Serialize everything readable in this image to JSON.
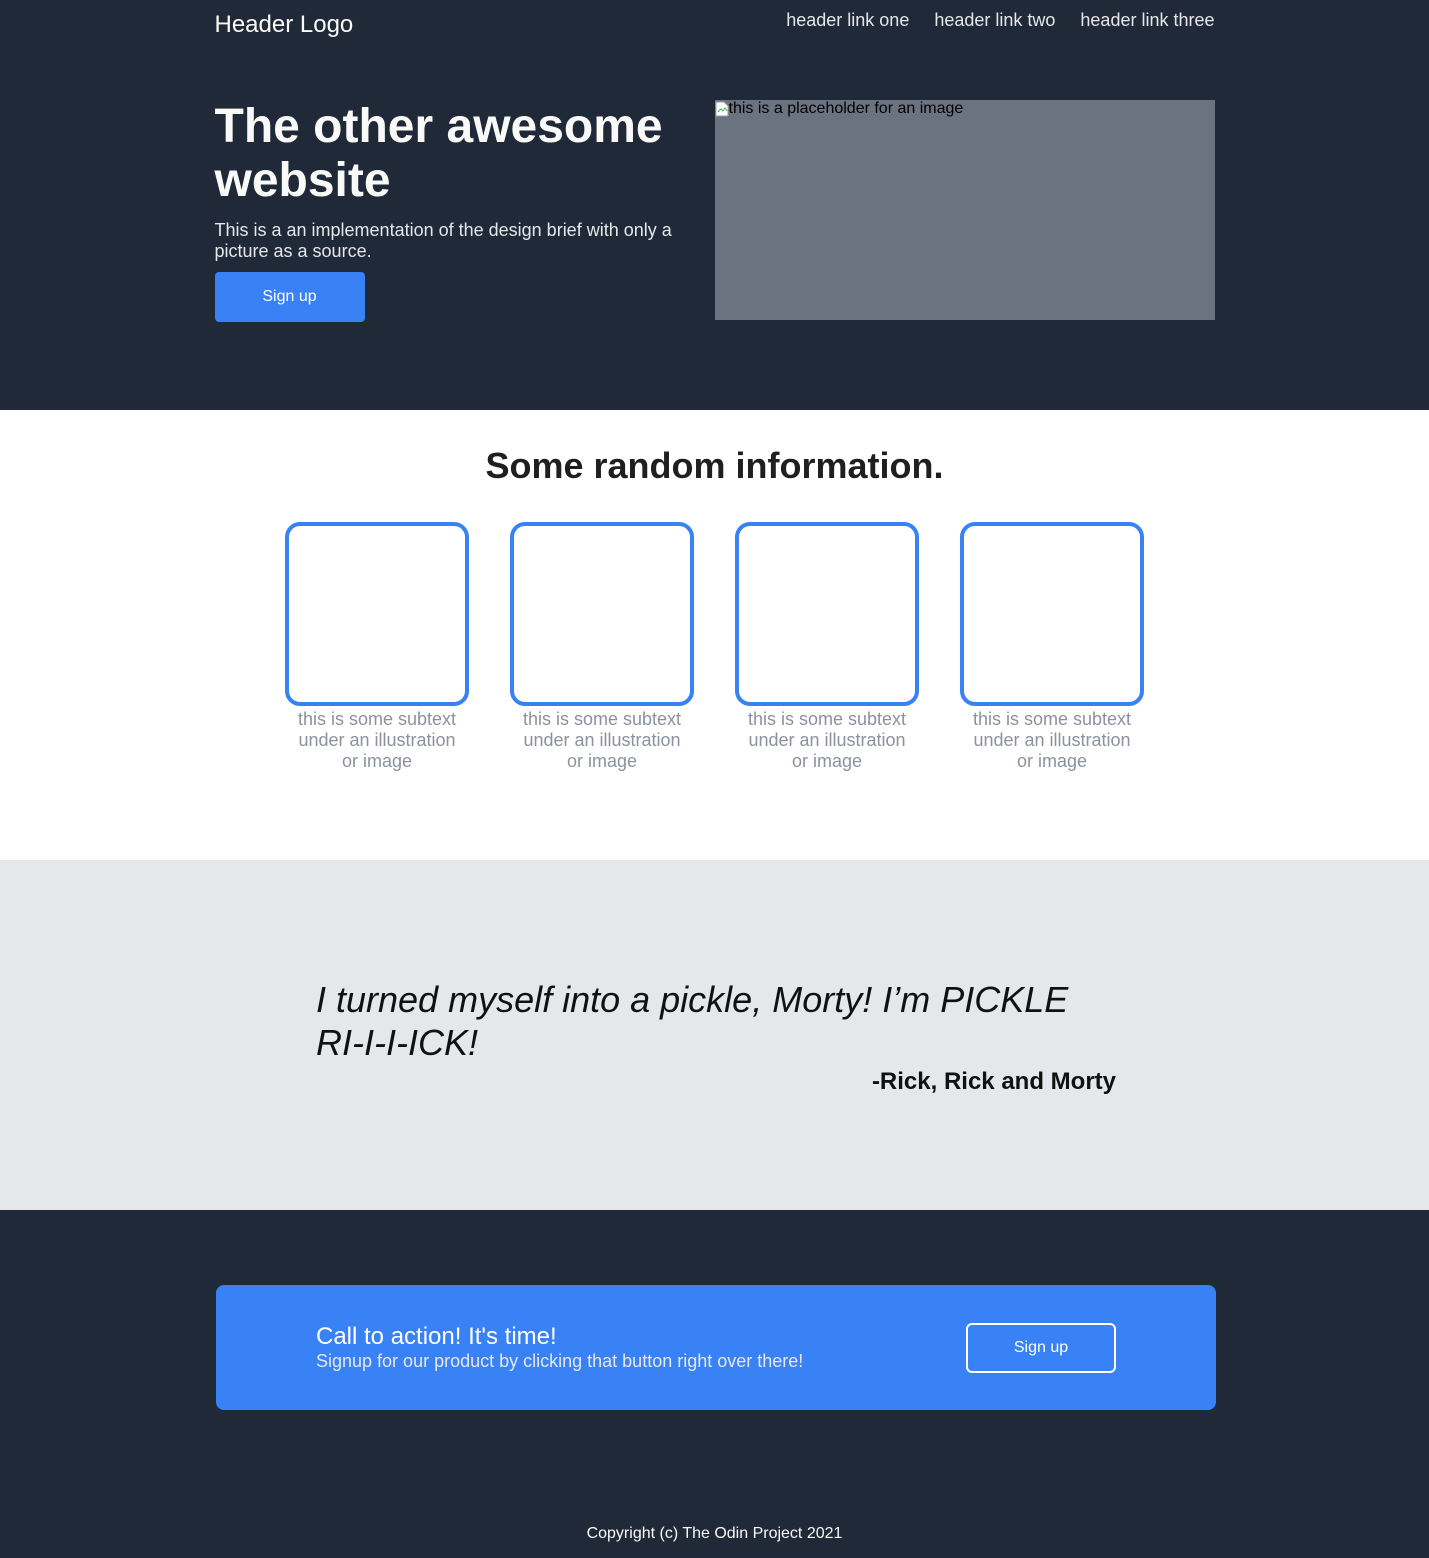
{
  "header": {
    "logo": "Header Logo",
    "links": [
      "header link one",
      "header link two",
      "header link three"
    ]
  },
  "hero": {
    "title": "The other awesome website",
    "text": "This is a an implementation of the design brief with only a picture as a source.",
    "button": "Sign up",
    "image_alt": "this is a placeholder for an image"
  },
  "info": {
    "title": "Some random information.",
    "cards": [
      "this is some subtext under an illustration or image",
      "this is some subtext under an illustration or image",
      "this is some subtext under an illustration or image",
      "this is some subtext under an illustration or image"
    ]
  },
  "quote": {
    "text": "I turned myself into a pickle, Morty! I’m PICKLE RI-I-I-ICK!",
    "author": "-Rick, Rick and Morty"
  },
  "cta": {
    "title": "Call to action! It's time!",
    "text": "Signup for our product by clicking that button right over there!",
    "button": "Sign up"
  },
  "footer": {
    "copyright": "Copyright (c) The Odin Project 2021"
  },
  "colors": {
    "dark": "#1f2937",
    "accent": "#3882f6",
    "light_gray": "#e5e7eb",
    "image_gray": "#6b7280"
  }
}
